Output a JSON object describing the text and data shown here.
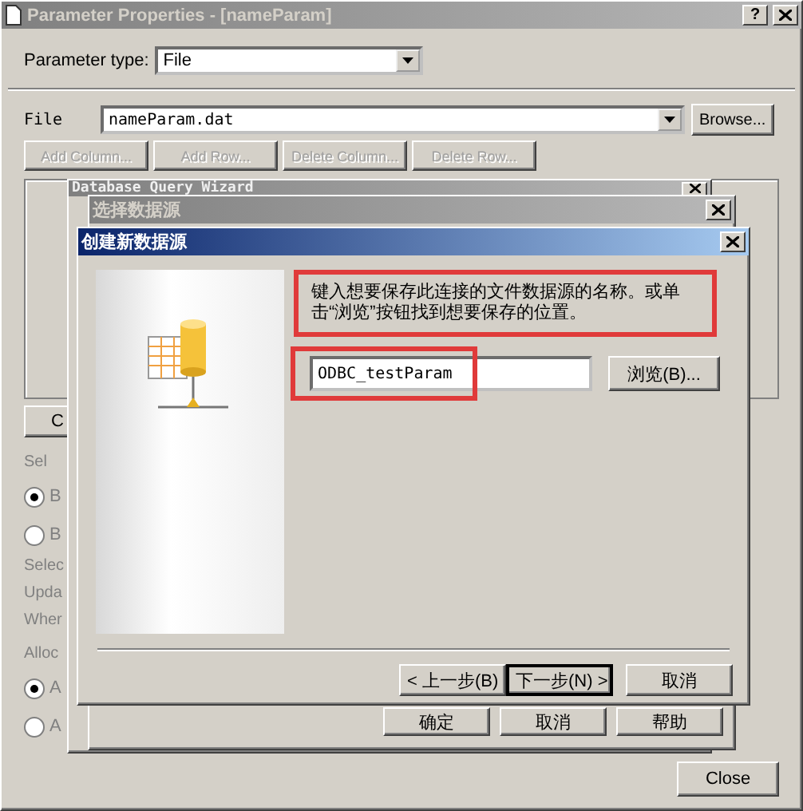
{
  "main_window": {
    "title": "Parameter Properties - [nameParam]",
    "help_button": "?",
    "parameter_type": {
      "label": "Parameter type:",
      "value": "File"
    },
    "file": {
      "label": "File",
      "value": "nameParam.dat"
    },
    "browse_button": "Browse...",
    "grid_buttons": [
      {
        "label": "Add Column...",
        "disabled": true
      },
      {
        "label": "Add Row...",
        "disabled": true
      },
      {
        "label": "Delete Column...",
        "disabled": true
      },
      {
        "label": "Delete Row...",
        "disabled": true
      }
    ],
    "left_fragments": [
      {
        "kind": "button",
        "label": "C"
      },
      {
        "kind": "group",
        "label": "Sel"
      },
      {
        "kind": "radio",
        "label": "B",
        "selected": true
      },
      {
        "kind": "radio",
        "label": "B",
        "selected": false
      },
      {
        "kind": "label",
        "label": "Selec"
      },
      {
        "kind": "label",
        "label": "Upda"
      },
      {
        "kind": "label",
        "label": "Wher"
      },
      {
        "kind": "group",
        "label": "Alloc"
      },
      {
        "kind": "radio",
        "label": "A",
        "selected": true
      },
      {
        "kind": "radio",
        "label": "A",
        "selected": false
      }
    ],
    "close_button": "Close"
  },
  "wizard_window": {
    "title": "Database Query Wizard",
    "active": false
  },
  "select_window": {
    "title": "选择数据源",
    "active": false,
    "buttons": [
      "确定",
      "取消",
      "帮助"
    ]
  },
  "create_dialog": {
    "title": "创建新数据源",
    "active": true,
    "instruction": {
      "text": "键入想要保存此连接的文件数据源的名称。或单击“浏览”按钮找到想要保存的位置。",
      "highlighted": true
    },
    "name_field": {
      "value": "ODBC_testParam",
      "highlighted": true
    },
    "browse_button": "浏览(B)...",
    "buttons": [
      {
        "label": "< 上一步(B)",
        "default": false
      },
      {
        "label": "下一步(N) >",
        "default": true
      },
      {
        "label": "取消",
        "default": false
      }
    ]
  }
}
